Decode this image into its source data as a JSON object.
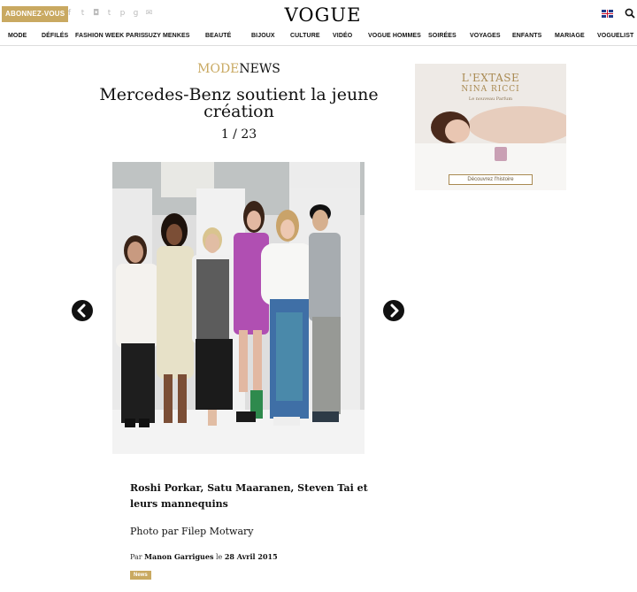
{
  "header": {
    "subscribe_label": "ABONNEZ-VOUS",
    "logo": "VOGUE",
    "social_icons": [
      "facebook-icon",
      "twitter-icon",
      "instagram-icon",
      "tumblr-icon",
      "pinterest-icon",
      "googleplus-icon",
      "mail-icon"
    ],
    "social_glyphs": [
      "f",
      "t",
      "o",
      "t",
      "p",
      "g",
      "m"
    ],
    "language_icon": "uk-flag-icon",
    "search_icon": "search-icon"
  },
  "nav": {
    "items": [
      "MODE",
      "DÉFILÉS",
      "FASHION WEEK PARIS",
      "SUZY MENKES",
      "BEAUTÉ",
      "BIJOUX",
      "CULTURE",
      "VIDÉO",
      "VOGUE HOMMES",
      "SOIRÉES",
      "VOYAGES",
      "ENFANTS",
      "MARIAGE",
      "VOGUELIST"
    ]
  },
  "article": {
    "kicker_part1": "MODE",
    "kicker_part2": "NEWS",
    "title": "Mercedes-Benz soutient la jeune création",
    "counter": "1 / 23",
    "caption": "Roshi Porkar, Satu Maaranen, Steven Tai et leurs mannequins",
    "photo_credit": "Photo par Filep Motwary",
    "byline_prefix": "Par",
    "author": "Manon Garrigues",
    "byline_mid": "le",
    "date": "28 Avril 2015",
    "tag": "News"
  },
  "gallery": {
    "prev_icon": "chevron-left-icon",
    "next_icon": "chevron-right-icon"
  },
  "ad": {
    "title": "L'EXTASE",
    "brand": "NINA RICCI",
    "subtitle": "Le nouveau Parfum",
    "cta": "Découvrez l'histoire"
  },
  "colors": {
    "accent_gold": "#c9a961",
    "text": "#111111"
  }
}
